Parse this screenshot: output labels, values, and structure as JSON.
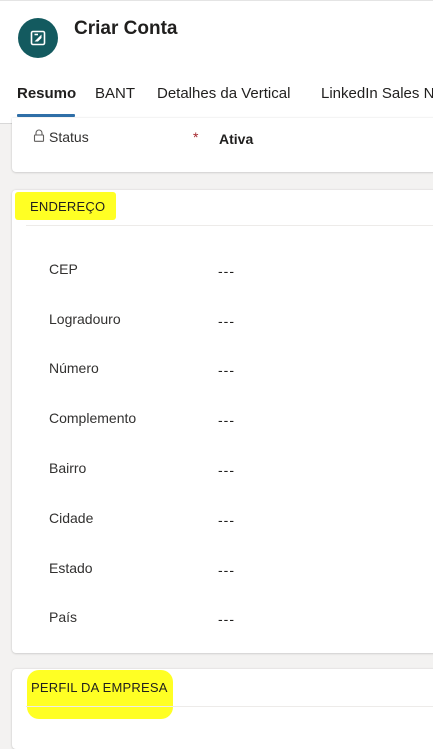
{
  "header": {
    "title": "Criar Conta",
    "icon": "entity-record-icon",
    "avatar_color": "#135a5f"
  },
  "tabs": [
    {
      "label": "Resumo",
      "active": true
    },
    {
      "label": "BANT",
      "active": false
    },
    {
      "label": "Detalhes da Vertical",
      "active": false
    },
    {
      "label": "LinkedIn Sales N",
      "active": false
    }
  ],
  "status_field": {
    "label": "Status",
    "required_marker": "*",
    "value": "Ativa",
    "icon": "lock-icon"
  },
  "address_section": {
    "title": "ENDEREÇO",
    "highlight_color": "#ffff24",
    "fields": [
      {
        "label": "CEP",
        "value": "---"
      },
      {
        "label": "Logradouro",
        "value": "---"
      },
      {
        "label": "Número",
        "value": "---"
      },
      {
        "label": "Complemento",
        "value": "---"
      },
      {
        "label": "Bairro",
        "value": "---"
      },
      {
        "label": "Cidade",
        "value": "---"
      },
      {
        "label": "Estado",
        "value": "---"
      },
      {
        "label": "País",
        "value": "---"
      }
    ]
  },
  "profile_section": {
    "title": "PERFIL DA EMPRESA",
    "highlight_color": "#ffff24"
  },
  "colors": {
    "tab_underline": "#2f6fa8",
    "required": "#a4262c"
  }
}
